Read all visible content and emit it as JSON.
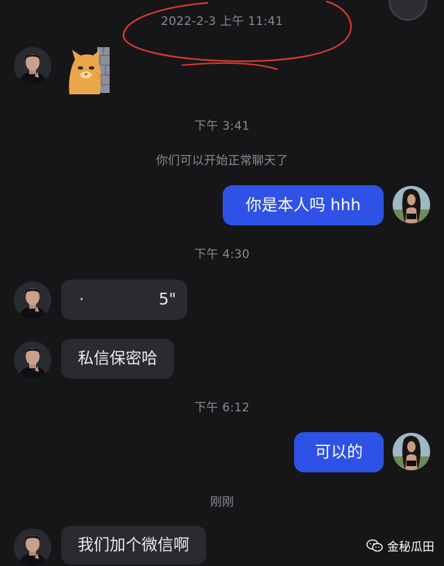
{
  "timestamps": {
    "first": "2022-2-3 上午 11:41",
    "second": "下午 3:41",
    "third": "下午 4:30",
    "fourth": "下午 6:12",
    "fifth": "刚刚"
  },
  "system_notice": "你们可以开始正常聊天了",
  "messages": {
    "out_1": "你是本人吗 hhh",
    "in_1_dot": "·",
    "in_1_text": "5\"",
    "in_2": "私信保密哈",
    "out_2": "可以的",
    "in_3": "我们加个微信啊"
  },
  "watermark": {
    "label": "金秘瓜田",
    "icon": "wechat-icon"
  },
  "colors": {
    "background": "#161619",
    "incoming_bubble": "#2a2a2f",
    "outgoing_bubble": "#2f52e6",
    "annotation_red": "#e03a2f"
  }
}
